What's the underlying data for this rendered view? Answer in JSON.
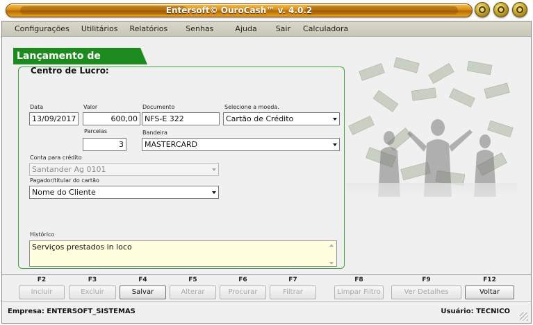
{
  "window": {
    "title": "Entersoft© OuroCash™ v. 4.0.2"
  },
  "menu": {
    "items": [
      "Configurações",
      "Utilitários",
      "Relatórios",
      "Senhas",
      "Ajuda",
      "Sair",
      "Calculadora"
    ]
  },
  "form": {
    "title": "Lançamento de Receitas",
    "subtitle": "Centro de Lucro:",
    "data": {
      "label": "Data",
      "value": "13/09/2017"
    },
    "valor": {
      "label": "Valor",
      "value": "600,00"
    },
    "documento": {
      "label": "Documento",
      "value": "NFS-E 322"
    },
    "moeda": {
      "label": "Selecione a moeda.",
      "value": "Cartão de Crédito"
    },
    "parcelas": {
      "label": "Parcelas",
      "value": "3"
    },
    "bandeira": {
      "label": "Bandeira",
      "value": "MASTERCARD"
    },
    "conta": {
      "label": "Conta para crédito",
      "value": "Santander Ag 0101"
    },
    "pagador": {
      "label": "Pagador/titular do cartão",
      "value": "Nome do Cliente"
    },
    "historico": {
      "label": "Histórico",
      "value": "Serviços prestados in loco"
    }
  },
  "fkeys": [
    {
      "key": "F2",
      "label": "Incluir",
      "enabled": false
    },
    {
      "key": "F3",
      "label": "Excluir",
      "enabled": false
    },
    {
      "key": "F4",
      "label": "Salvar",
      "enabled": true
    },
    {
      "key": "F5",
      "label": "Alterar",
      "enabled": false
    },
    {
      "key": "F6",
      "label": "Procurar",
      "enabled": false
    },
    {
      "key": "F7",
      "label": "Filtrar",
      "enabled": false
    },
    {
      "key": "F8",
      "label": "Limpar Filtro",
      "enabled": false
    },
    {
      "key": "F9",
      "label": "Ver Detalhes",
      "enabled": false
    },
    {
      "key": "F12",
      "label": "Voltar",
      "enabled": true
    }
  ],
  "status": {
    "empresa": "Empresa: ENTERSOFT_SISTEMAS",
    "usuario": "Usuário: TECNICO"
  },
  "colors": {
    "accent_green": "#1d8a1d",
    "title_gold": "#d98c10",
    "memo_bg": "#ffffe0"
  },
  "icons": [
    "minimize-icon",
    "maximize-icon",
    "close-icon",
    "resize-grip-icon"
  ]
}
